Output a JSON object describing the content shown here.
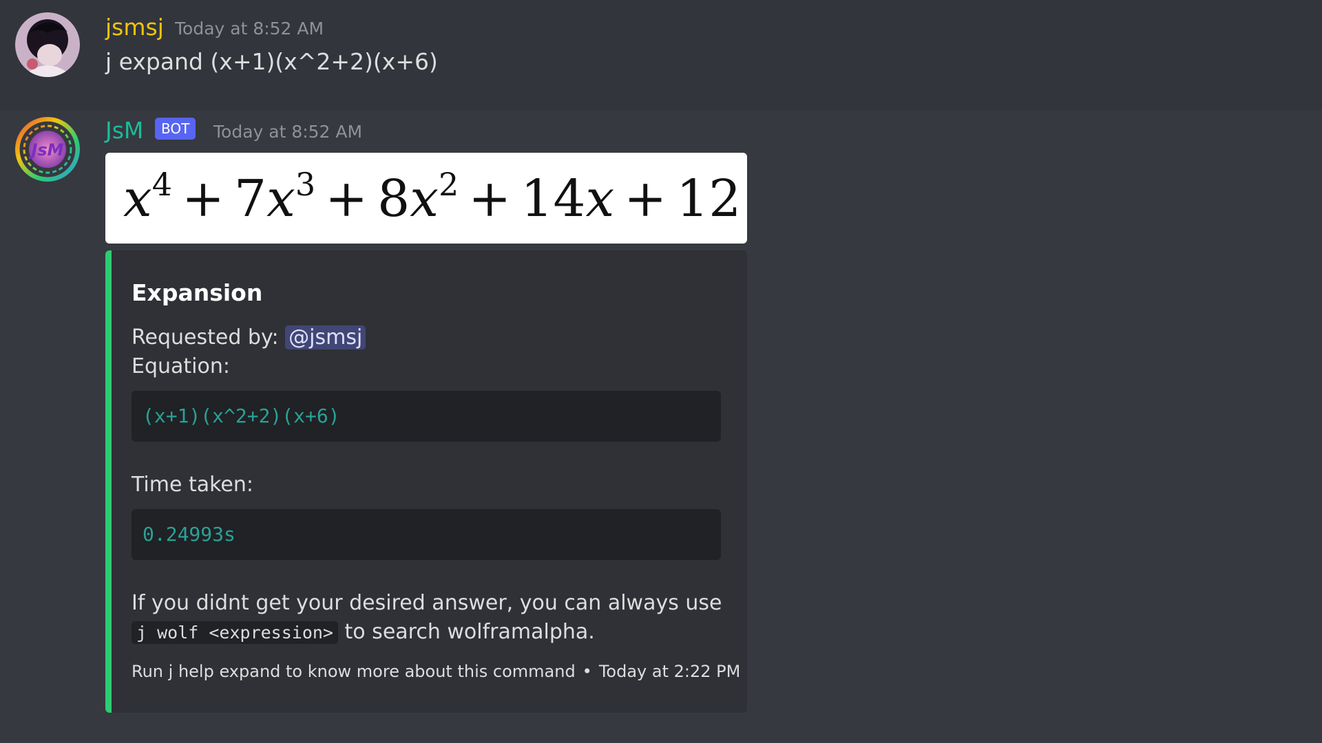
{
  "user_message": {
    "username": "jsmsj",
    "timestamp": "Today at 8:52 AM",
    "content": "j expand (x+1)(x^2+2)(x+6)",
    "username_color": "#f1c40f"
  },
  "bot_message": {
    "username": "JsM",
    "bot_tag": "BOT",
    "timestamp": "Today at 8:52 AM",
    "username_color": "#1abc9c",
    "avatar_text": "JsM",
    "latex_result": {
      "t1_base": "x",
      "t1_exp": "4",
      "plus1": "+",
      "t2_coef": "7",
      "t2_base": "x",
      "t2_exp": "3",
      "plus2": "+",
      "t3_coef": "8",
      "t3_base": "x",
      "t3_exp": "2",
      "plus3": "+",
      "t4_coef": "14",
      "t4_base": "x",
      "plus4": "+",
      "t5": "12"
    },
    "embed": {
      "accent_color": "#2ecc71",
      "title": "Expansion",
      "requested_by_label": "Requested by:",
      "requested_by_mention": "@jsmsj",
      "equation_label": "Equation:",
      "equation_code": "(x+1)(x^2+2)(x+6)",
      "time_label": "Time taken:",
      "time_code": "0.24993s",
      "hint_line1": "If you didnt get your desired answer, you can always use",
      "hint_code": "j wolf <expression>",
      "hint_line2": "to search wolframalpha.",
      "footer_text": "Run j help expand to know more about this command",
      "footer_separator": "•",
      "footer_timestamp": "Today at 2:22 PM"
    }
  }
}
